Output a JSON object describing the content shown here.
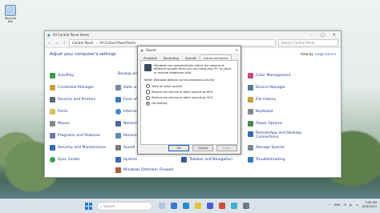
{
  "desktop": {
    "recycle_bin_label": "Recycle Bin"
  },
  "control_panel": {
    "window_title": "All Control Panel Items",
    "breadcrumb": [
      "Control Panel",
      "All Control Panel Items"
    ],
    "search_placeholder": "Search Control Panel",
    "heading": "Adjust your computer's settings",
    "view_by_label": "View by:",
    "view_by_value": "Large icons ▾",
    "items_left": [
      "AutoPlay",
      "Credential Manager",
      "Devices and Printers",
      "Fonts",
      "Mouse",
      "Programs and Features",
      "Security and Maintenance",
      "Sync Center"
    ],
    "items_mid": [
      "Backup and Restore (Windows 7)",
      "Date and Time",
      "Ease of Access Center",
      "Internet Options",
      "Network and Sharing Center",
      "Recovery",
      "Sound",
      "System",
      "Windows Defender Firewall"
    ],
    "items_right": [
      "Color Management",
      "Device Manager",
      "File History",
      "Keyboard",
      "Power Options",
      "RemoteApp and Desktop Connections",
      "Storage Spaces",
      "Troubleshooting"
    ],
    "items_mid2": [
      "Taskbar and Navigation"
    ],
    "colors": {
      "link": "#1a3a8a"
    }
  },
  "sound_dialog": {
    "title": "Sound",
    "tabs": [
      "Playback",
      "Recording",
      "Sounds",
      "Communications"
    ],
    "active_tab": "Communications",
    "description": "Windows can automatically adjust the volume of different sounds when you are using your PC to place or receive telephone calls.",
    "question": "When Windows detects communications activity:",
    "options": [
      "Mute all other sounds",
      "Reduce the volume of other sounds by 80%",
      "Reduce the volume of other sounds by 50%",
      "Do nothing"
    ],
    "selected_option": 3,
    "buttons": {
      "ok": "OK",
      "cancel": "Cancel",
      "apply": "Apply"
    }
  },
  "taskbar": {
    "search_placeholder": "Search",
    "tray": {
      "lang": "ENG",
      "time": "3:08 PM",
      "date": "6/14/2023"
    }
  }
}
